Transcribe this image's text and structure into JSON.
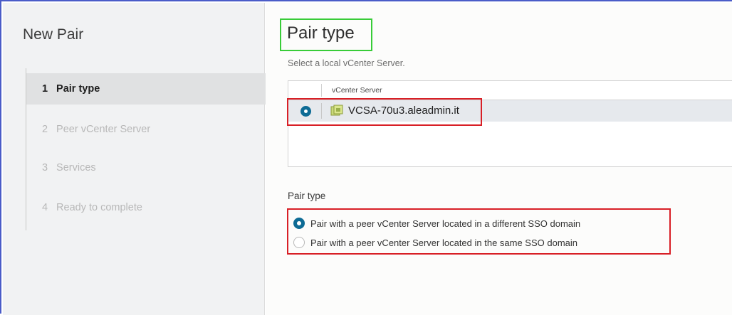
{
  "sidebar": {
    "title": "New Pair",
    "steps": [
      {
        "num": "1",
        "label": "Pair type"
      },
      {
        "num": "2",
        "label": "Peer vCenter Server"
      },
      {
        "num": "3",
        "label": "Services"
      },
      {
        "num": "4",
        "label": "Ready to complete"
      }
    ],
    "active_step": 1
  },
  "main": {
    "title": "Pair type",
    "subtitle": "Select a local vCenter Server.",
    "grid": {
      "column_header": "vCenter Server",
      "rows": [
        {
          "name": "VCSA-70u3.aleadmin.it",
          "selected": true,
          "icon": "vcenter-server-icon"
        }
      ]
    },
    "pair_type": {
      "label": "Pair type",
      "options": [
        {
          "label": "Pair with a peer vCenter Server located in a different SSO domain",
          "checked": true
        },
        {
          "label": "Pair with a peer vCenter Server located in the same SSO domain",
          "checked": false
        }
      ]
    }
  },
  "colors": {
    "accent": "#0d6b95",
    "highlight_green": "#38cc38",
    "highlight_red": "#d81f26",
    "window_border": "#4a5cc8"
  }
}
